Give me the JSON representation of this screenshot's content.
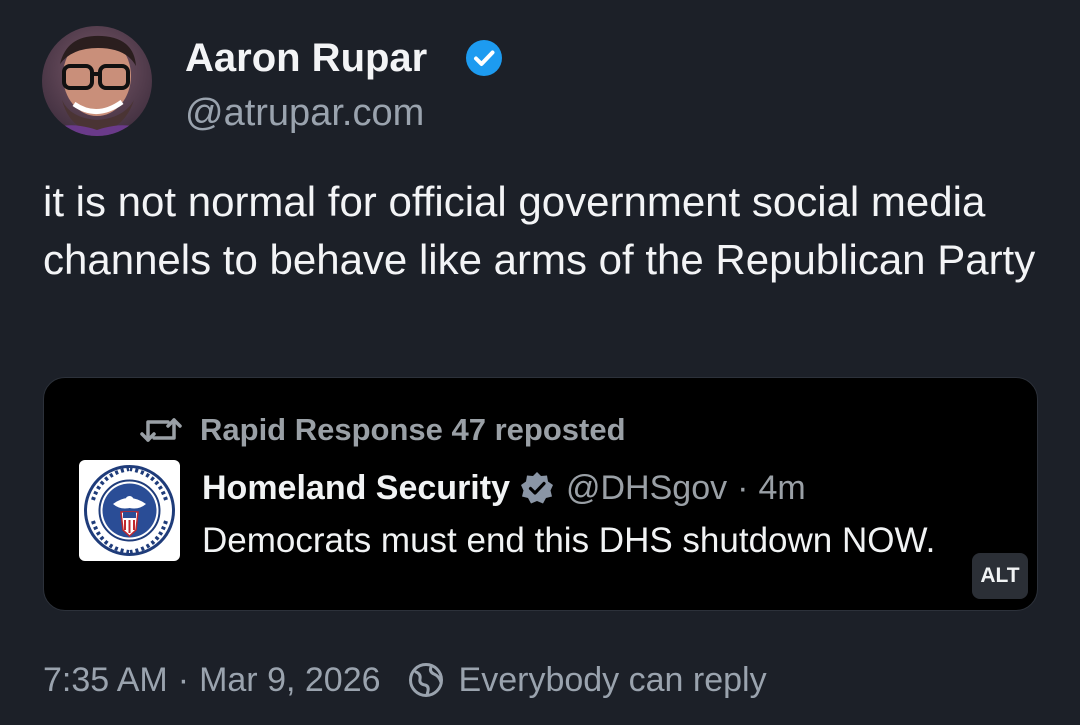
{
  "post": {
    "author": {
      "name": "Aaron Rupar",
      "handle": "@atrupar.com",
      "verified": true,
      "avatar_icon": "avatar-photo"
    },
    "text": "it is not normal for official government social media channels to behave like arms of the Republican Party",
    "embed": {
      "repost_text": "Rapid Response 47 reposted",
      "repost_icon": "repost-icon",
      "account_name": "Homeland Security",
      "account_verified": true,
      "account_handle": "@DHSgov",
      "separator": "·",
      "time_ago": "4m",
      "text": "Democrats must end this DHS shutdown NOW.",
      "logo": "dhs-seal-icon",
      "alt_label": "ALT"
    },
    "footer": {
      "time": "7:35 AM",
      "separator": "·",
      "date": "Mar 9, 2026",
      "reply_icon": "globe-icon",
      "reply_setting": "Everybody can reply"
    }
  },
  "colors": {
    "background": "#1c2028",
    "text_primary": "#f3f4f6",
    "text_secondary": "#9aa3ae",
    "verified_blue": "#1d9bf0",
    "embed_background": "#000000"
  }
}
